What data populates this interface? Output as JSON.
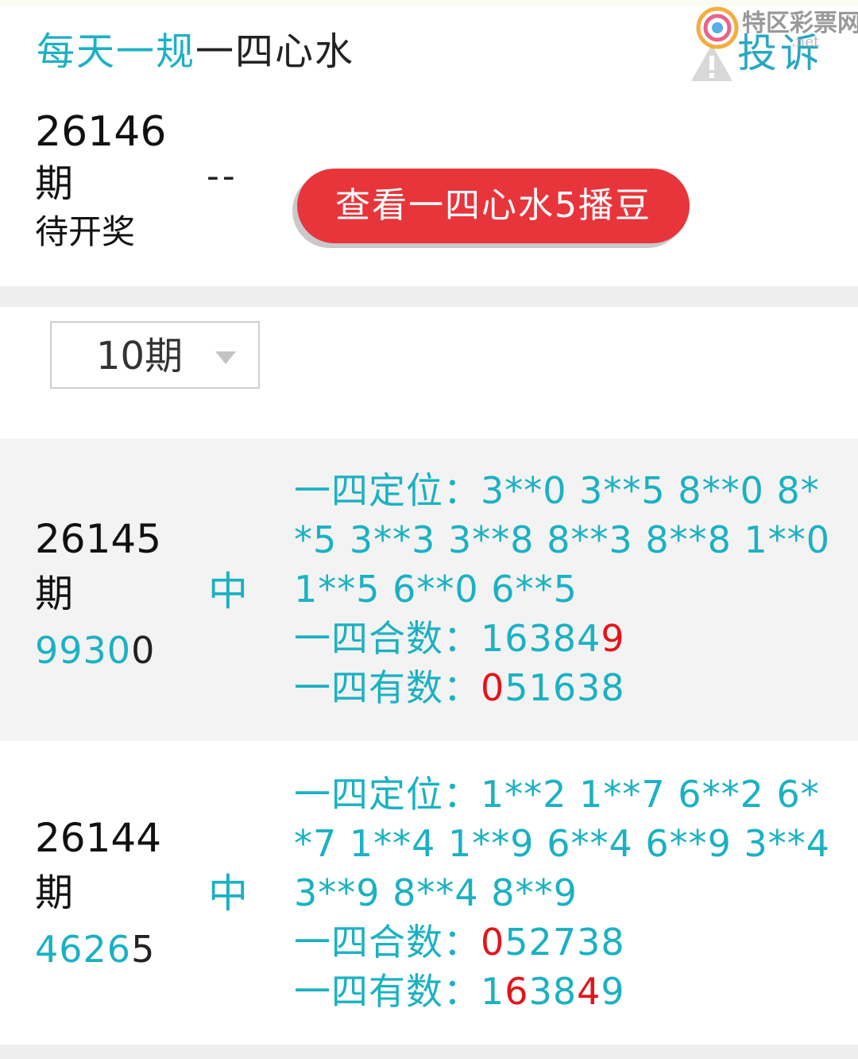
{
  "header": {
    "title_colored": "每天一规",
    "title_plain": "一四心水",
    "complain_label": "投诉",
    "watermark": "特区彩票网",
    "watermark_sub": ".net"
  },
  "current": {
    "issue": "26146",
    "issue_suffix": "期",
    "status": "待开奖",
    "result": "--",
    "view_button": "查看一四心水5播豆"
  },
  "selector": {
    "value": "10期"
  },
  "rows": [
    {
      "issue": "26145",
      "issue_suffix": "期",
      "result_main": "9930",
      "result_last": "0",
      "hit": "中",
      "position_label": "一四定位：",
      "position_values": "3**0 3**5 8**0 8**5 3**3 3**8 8**3 8**8 1**0 1**5 6**0 6**5",
      "sum_label": "一四合数：",
      "sum_a": "16384",
      "sum_red": "9",
      "have_label": "一四有数：",
      "have_red": "0",
      "have_b": "51638"
    },
    {
      "issue": "26144",
      "issue_suffix": "期",
      "result_main": "4626",
      "result_last": "5",
      "hit": "中",
      "position_label": "一四定位：",
      "position_values": "1**2 1**7 6**2 6**7 1**4 1**9 6**4 6**9 3**4 3**9 8**4 8**9",
      "sum_label": "一四合数：",
      "sum_red": "0",
      "sum_b": "52738",
      "have_label": "一四有数：",
      "have_a": "1",
      "have_red1": "6",
      "have_b": "38",
      "have_red2": "4",
      "have_c": "9"
    }
  ],
  "colors": {
    "accent": "#1bb1c3",
    "button": "#e8353b",
    "highlight": "#e3141b"
  },
  "icons": [
    "warning-icon",
    "watermark-logo-icon",
    "dropdown-caret-icon"
  ]
}
